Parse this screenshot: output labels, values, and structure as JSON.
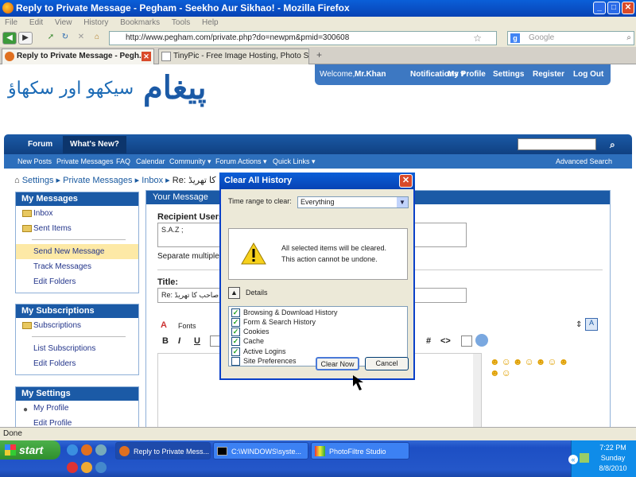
{
  "window": {
    "title": "Reply to Private Message - Pegham - Seekho Aur Sikhao! - Mozilla Firefox"
  },
  "menu": [
    "File",
    "Edit",
    "View",
    "History",
    "Bookmarks",
    "Tools",
    "Help"
  ],
  "url": "http://www.pegham.com/private.php?do=newpm&pmid=300608",
  "search_placeholder": "Google",
  "tabs": [
    {
      "label": "Reply to Private Message - Pegh..."
    },
    {
      "label": "TinyPic - Free Image Hosting, Photo Sh..."
    }
  ],
  "site": {
    "logo_main": "پیغام",
    "logo_sub": "سیکھو اور سکھاؤ",
    "user_nav": {
      "welcome": "Welcome,",
      "user": "Mr.Khan",
      "notifications": "Notifications ▾",
      "profile": "My Profile",
      "settings": "Settings",
      "register": "Register",
      "logout": "Log Out"
    },
    "forumbar": {
      "forum": "Forum",
      "whats_new": "What's New?"
    },
    "subnav": [
      "New Posts",
      "Private Messages",
      "FAQ",
      "Calendar",
      "Community ▾",
      "Forum Actions ▾",
      "Quick Links ▾"
    ],
    "advanced_search": "Advanced Search",
    "breadcrumb": [
      "Settings",
      "Private Messages",
      "Inbox",
      "Re: کا تھریڈ"
    ],
    "my_messages": {
      "title": "My Messages",
      "items": [
        "Inbox",
        "Sent Items",
        "Send New Message",
        "Track Messages",
        "Edit Folders"
      ]
    },
    "my_subscriptions": {
      "title": "My Subscriptions",
      "items": [
        "Subscriptions",
        "List Subscriptions",
        "Edit Folders"
      ]
    },
    "my_settings": {
      "title": "My Settings",
      "items": [
        "My Profile",
        "Edit Profile"
      ]
    },
    "main": {
      "header": "Your Message",
      "recipient_label": "Recipient Users",
      "recipient_value": "S.A.Z ;",
      "separate_note": "Separate multiple",
      "title_label": "Title:",
      "title_value": "Re: صاحب کا تھریڈ",
      "font_label": "Fonts",
      "toolbar": [
        "B",
        "I",
        "U"
      ]
    }
  },
  "dialog": {
    "title": "Clear All History",
    "time_range_label": "Time range to clear:",
    "time_range_value": "Everything",
    "warning_line1": "All selected items will be cleared.",
    "warning_line2": "This action cannot be undone.",
    "details_label": "Details",
    "items": [
      {
        "label": "Browsing & Download History",
        "checked": true
      },
      {
        "label": "Form & Search History",
        "checked": true
      },
      {
        "label": "Cookies",
        "checked": true
      },
      {
        "label": "Cache",
        "checked": true
      },
      {
        "label": "Active Logins",
        "checked": true
      },
      {
        "label": "Site Preferences",
        "checked": false
      }
    ],
    "clear_now": "Clear Now",
    "cancel": "Cancel"
  },
  "status": "Done",
  "taskbar": {
    "start": "start",
    "tasks": [
      "Reply to Private Mess...",
      "C:\\WINDOWS\\syste...",
      "PhotoFiltre Studio"
    ],
    "time": "7:22 PM",
    "day": "Sunday",
    "date": "8/8/2010"
  },
  "colors": {
    "accent": "#1b5aa6",
    "xp_title": "#0a5fd8",
    "start_green": "#3a9d38"
  }
}
